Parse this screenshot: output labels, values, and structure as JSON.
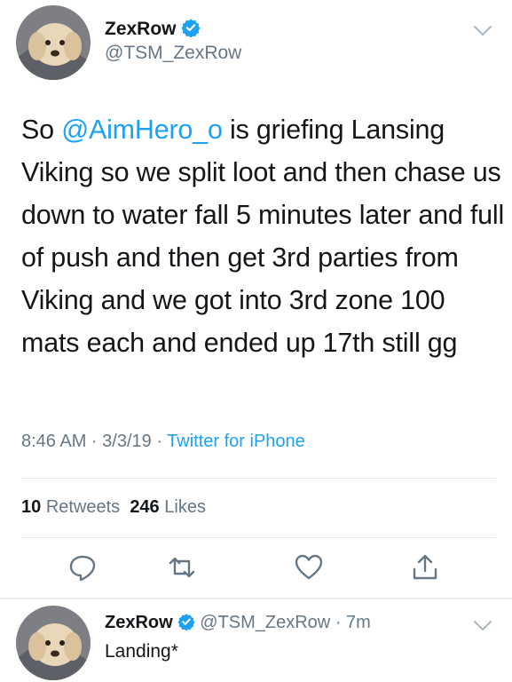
{
  "tweet": {
    "author_name": "ZexRow",
    "author_handle": "@TSM_ZexRow",
    "text_prefix": "So ",
    "mention": "@AimHero_o",
    "text_suffix": " is griefing Lansing Viking so we split loot and then chase us down to water fall 5 minutes later and full of push and then get 3rd parties from Viking and we got into 3rd zone 100 mats each and ended up 17th still gg",
    "time": "8:46 AM · 3/3/19 · ",
    "source": "Twitter for iPhone",
    "retweets_count": "10",
    "retweets_label": "Retweets",
    "likes_count": "246",
    "likes_label": "Likes"
  },
  "reply": {
    "author_name": "ZexRow",
    "author_handle": "@TSM_ZexRow",
    "age": "· 7m",
    "text": "Landing*"
  },
  "icons": {
    "verified": "verified-badge-icon",
    "chevron": "chevron-down-icon",
    "reply": "reply-icon",
    "retweet": "retweet-icon",
    "like": "heart-icon",
    "share": "share-icon"
  },
  "colors": {
    "accent": "#1da1f2",
    "secondary_text": "#657786",
    "divider": "#e1e8ed"
  }
}
